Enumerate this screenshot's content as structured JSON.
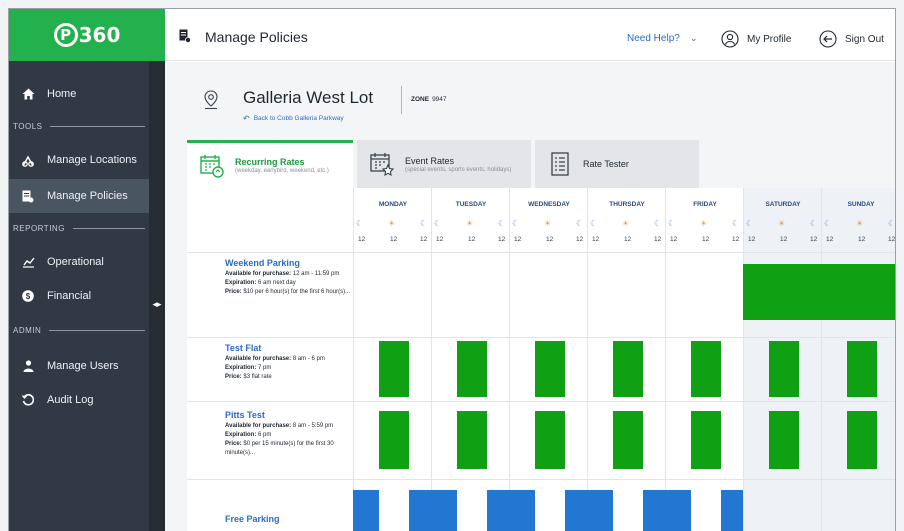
{
  "sidebar": {
    "logo": "360",
    "logo_mark": "P",
    "items": [
      {
        "label": "Home",
        "icon": "home-icon",
        "active": false
      },
      {
        "label": "Manage Locations",
        "icon": "locations-icon",
        "active": false
      },
      {
        "label": "Manage Policies",
        "icon": "policies-icon",
        "active": true
      },
      {
        "label": "Operational",
        "icon": "chart-icon",
        "active": false
      },
      {
        "label": "Financial",
        "icon": "dollar-icon",
        "active": false
      },
      {
        "label": "Manage Users",
        "icon": "user-icon",
        "active": false
      },
      {
        "label": "Audit Log",
        "icon": "history-icon",
        "active": false
      }
    ],
    "sections": {
      "tools": "TOOLS",
      "reporting": "REPORTING",
      "admin": "ADMIN"
    },
    "collapse_glyph": "◂▸"
  },
  "header": {
    "title": "Manage Policies",
    "need_help": "Need Help?",
    "my_profile": "My Profile",
    "sign_out": "Sign Out"
  },
  "location": {
    "name": "Galleria West Lot",
    "back_link": "Back to Cobb Galleria Parkway",
    "zone_label": "ZONE",
    "zone_value": "9947"
  },
  "tabs": [
    {
      "title": "Recurring Rates",
      "subtitle": "(weekday, earlybird, weekend, etc.)",
      "active": true
    },
    {
      "title": "Event Rates",
      "subtitle": "(special events, sports events, holidays)",
      "active": false
    },
    {
      "title": "Rate Tester",
      "subtitle": "",
      "active": false
    }
  ],
  "days": [
    "MONDAY",
    "TUESDAY",
    "WEDNESDAY",
    "THURSDAY",
    "FRIDAY",
    "SATURDAY",
    "SUNDAY"
  ],
  "hour_label": "12",
  "policies": [
    {
      "name": "Weekend Parking",
      "purchase_label": "Available for purchase:",
      "purchase_value": "12 am - 11:59 pm",
      "expiration_label": "Expiration:",
      "expiration_value": "6 am next day",
      "price_label": "Price:",
      "price_value": "$10 per 6 hour(s) for the first 6 hour(s)..."
    },
    {
      "name": "Test Flat",
      "purchase_label": "Available for purchase:",
      "purchase_value": "8 am - 6 pm",
      "expiration_label": "Expiration:",
      "expiration_value": "7 pm",
      "price_label": "Price:",
      "price_value": "$3 flat rate"
    },
    {
      "name": "Pitts Test",
      "purchase_label": "Available for purchase:",
      "purchase_value": "8 am - 5:59 pm",
      "expiration_label": "Expiration:",
      "expiration_value": "6 pm",
      "price_label": "Price:",
      "price_value": "$0 per 15 minute(s) for the first 30 minute(s)..."
    },
    {
      "name": "Free Parking",
      "purchase_label": "",
      "purchase_value": "",
      "expiration_label": "",
      "expiration_value": "",
      "price_label": "",
      "price_value": ""
    }
  ],
  "colors": {
    "brand_green": "#22b14c",
    "rate_green": "#0fa014",
    "free_blue": "#2277d2",
    "sidebar": "#313a44",
    "link_blue": "#2a6cc4"
  }
}
